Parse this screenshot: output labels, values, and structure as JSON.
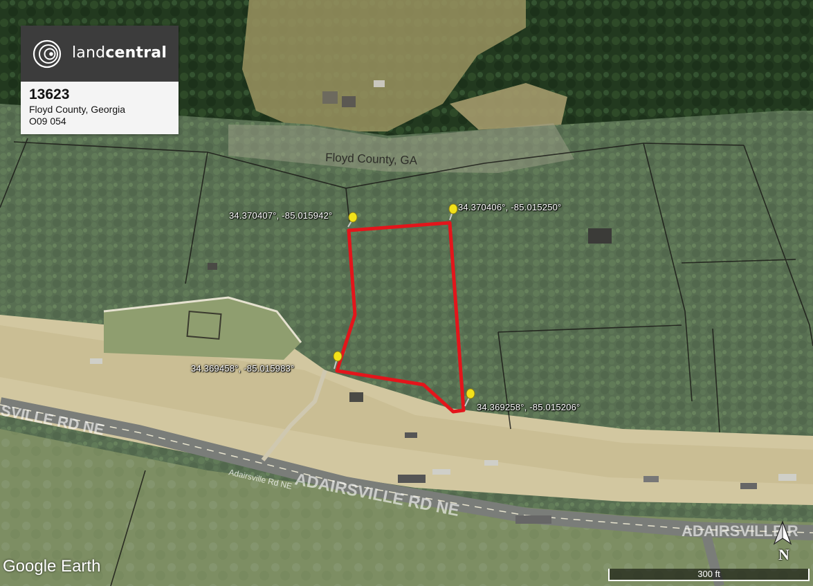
{
  "branding": {
    "logo_text_light": "land",
    "logo_text_bold": "central",
    "watermark": "Google Earth"
  },
  "parcel": {
    "id": "13623",
    "county_state": "Floyd County, Georgia",
    "parcel_number": "O09 054"
  },
  "map_labels": {
    "county": "Floyd County, GA",
    "road_main": "ADAIRSVILLE RD NE",
    "road_left": "SVILLE RD NE",
    "road_small": "Adairsville Rd NE",
    "road_right": "ADAIRSVILLE R"
  },
  "corners": [
    {
      "label": "34.370407°, -85.015942°"
    },
    {
      "label": "34.370406°, -85.015250°"
    },
    {
      "label": "34.369458°, -85.015983°"
    },
    {
      "label": "34.369258°, -85.015206°"
    }
  ],
  "scale": {
    "label": "300 ft"
  },
  "compass": {
    "north": "N",
    "icon": "north-arrow-icon"
  },
  "colors": {
    "boundary": "#e3151b",
    "pin": "#f2e21a",
    "panel_dark": "#3c3c3c",
    "panel_light": "#f4f4f4"
  }
}
